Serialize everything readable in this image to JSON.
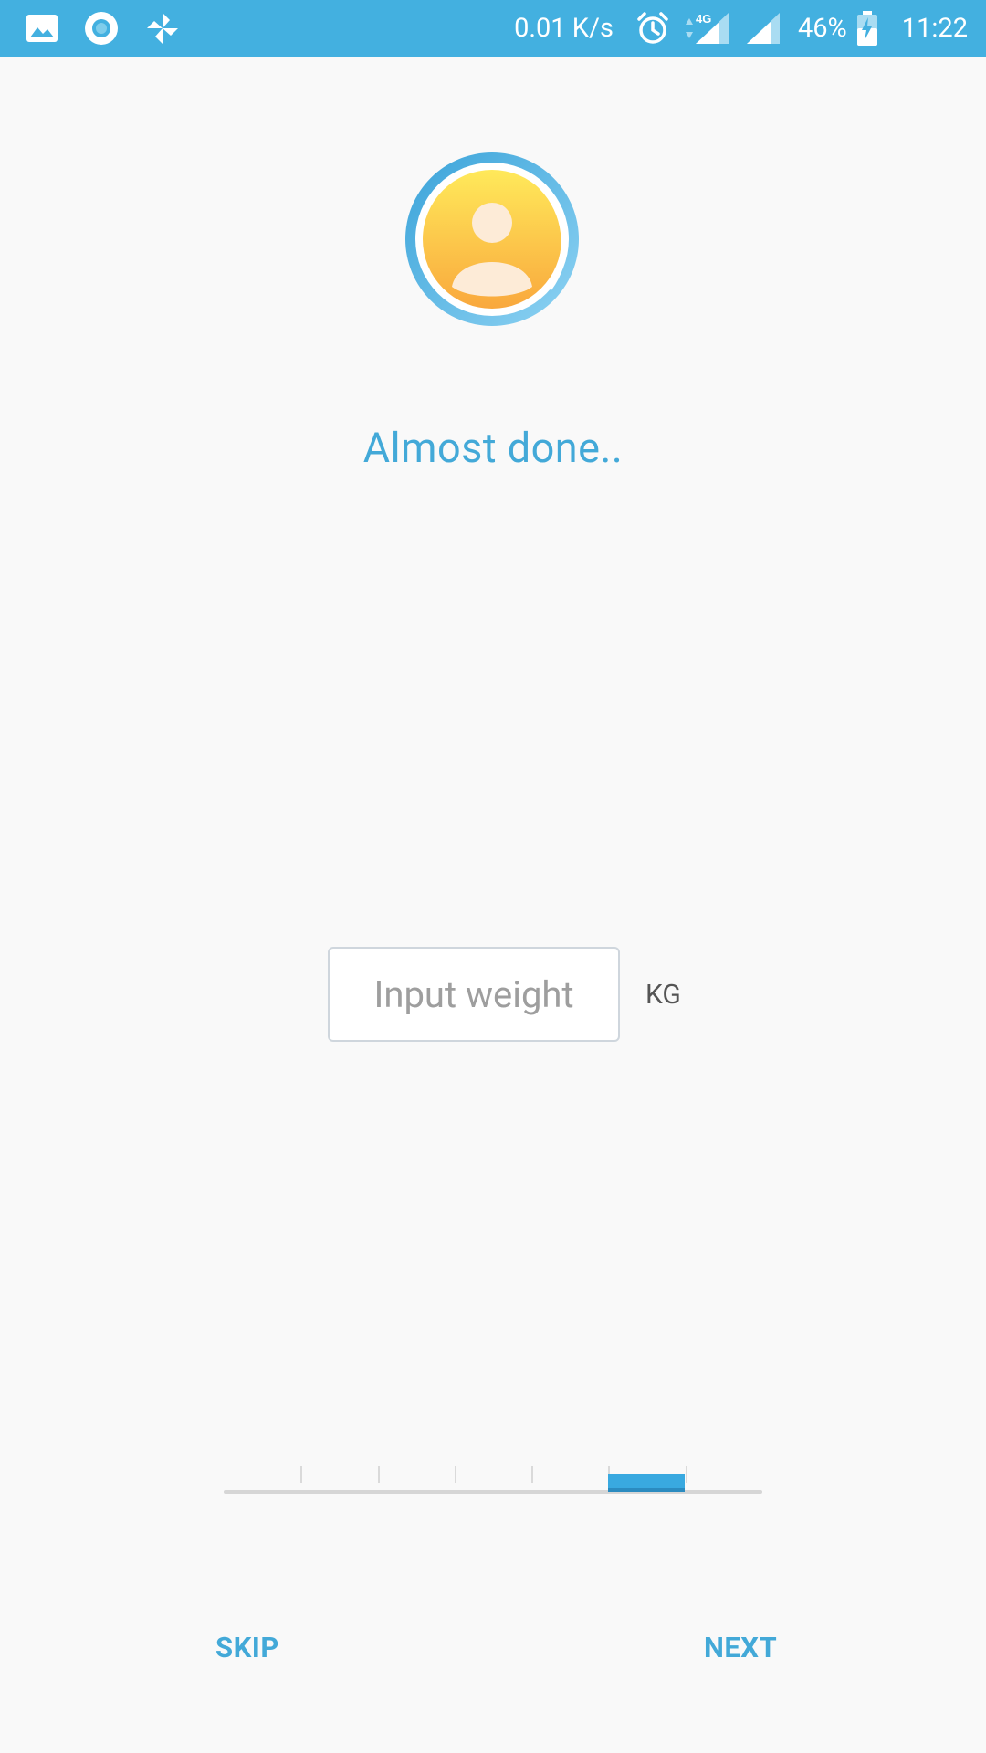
{
  "status_bar": {
    "left_icons": [
      "image-icon",
      "camera-circle-icon",
      "pinwheel-icon"
    ],
    "network_speed": "0.01 K/s",
    "network_type": "4G",
    "battery_percent": "46%",
    "time": "11:22"
  },
  "onboarding": {
    "title": "Almost done..",
    "weight_input": {
      "value": "",
      "placeholder": "Input weight"
    },
    "unit": "KG",
    "progress": {
      "total_steps": 7,
      "current_step": 6
    },
    "skip_label": "SKIP",
    "next_label": "NEXT"
  },
  "colors": {
    "status_bar": "#43b0e0",
    "accent": "#43a9d8",
    "background": "#f9f9f9",
    "progress_fill": "#39a9e0"
  }
}
